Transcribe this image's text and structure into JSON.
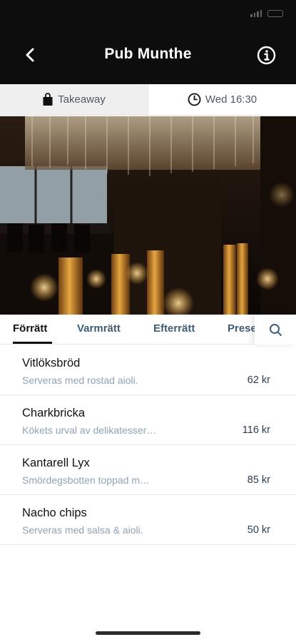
{
  "header": {
    "title": "Pub Munthe"
  },
  "orderbar": {
    "mode_label": "Takeaway",
    "time_label": "Wed 16:30"
  },
  "tabs": [
    {
      "label": "Förrätt",
      "active": true
    },
    {
      "label": "Varmrätt",
      "active": false
    },
    {
      "label": "Efterrätt",
      "active": false
    },
    {
      "label": "Prese",
      "active": false
    }
  ],
  "menu": [
    {
      "name": "Vitlöksbröd",
      "description": "Serveras med rostad aioli.",
      "price": "62 kr"
    },
    {
      "name": "Charkbricka",
      "description": "Kökets urval av delikatesser…",
      "price": "116 kr"
    },
    {
      "name": "Kantarell Lyx",
      "description": "Smördegsbotten toppad m…",
      "price": "85 kr"
    },
    {
      "name": "Nacho chips",
      "description": "Serveras med salsa & aioli.",
      "price": "50 kr"
    }
  ],
  "icons": {
    "back": "chevron-left-icon",
    "info": "info-icon",
    "takeaway": "shopping-bag-icon",
    "time": "clock-icon",
    "search": "search-icon"
  },
  "colors": {
    "header_bg": "#0d0d0d",
    "tab_inactive": "#3f5d74",
    "desc_text": "#8fa3b3"
  }
}
